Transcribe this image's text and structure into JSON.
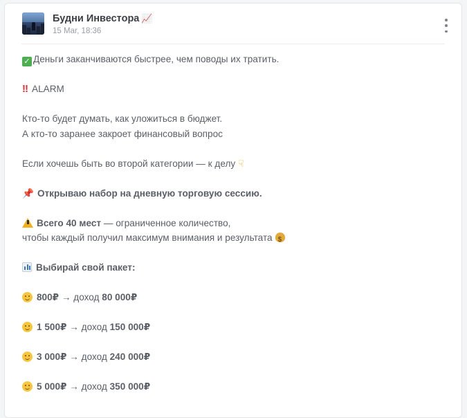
{
  "post": {
    "channel_name": "Будни Инвестора",
    "channel_emoji": "📈",
    "timestamp": "15 Mar, 18:36",
    "lines": [
      "Деньги заканчиваются быстрее, чем поводы их тратить.",
      "ALARM",
      "Кто-то будет думать, как уложиться в бюджет.",
      "А кто-то заранее закроет финансовый вопрос",
      "Если хочешь быть во второй категории — к делу",
      "Открываю набор на дневную торговую сессию.",
      "Всего 40 мест",
      " — ограниченное количество,",
      "чтобы каждый получил максимум внимания и результата",
      "Выбирай свой пакет:"
    ],
    "packages": [
      {
        "price": "800₽",
        "arrow": "→ доход",
        "income": "80 000₽"
      },
      {
        "price": "1 500₽",
        "arrow": "→ доход",
        "income": "150 000₽"
      },
      {
        "price": "3 000₽",
        "arrow": "→ доход",
        "income": "240 000₽"
      },
      {
        "price": "5 000₽",
        "arrow": "→ доход",
        "income": "350 000₽"
      }
    ]
  }
}
